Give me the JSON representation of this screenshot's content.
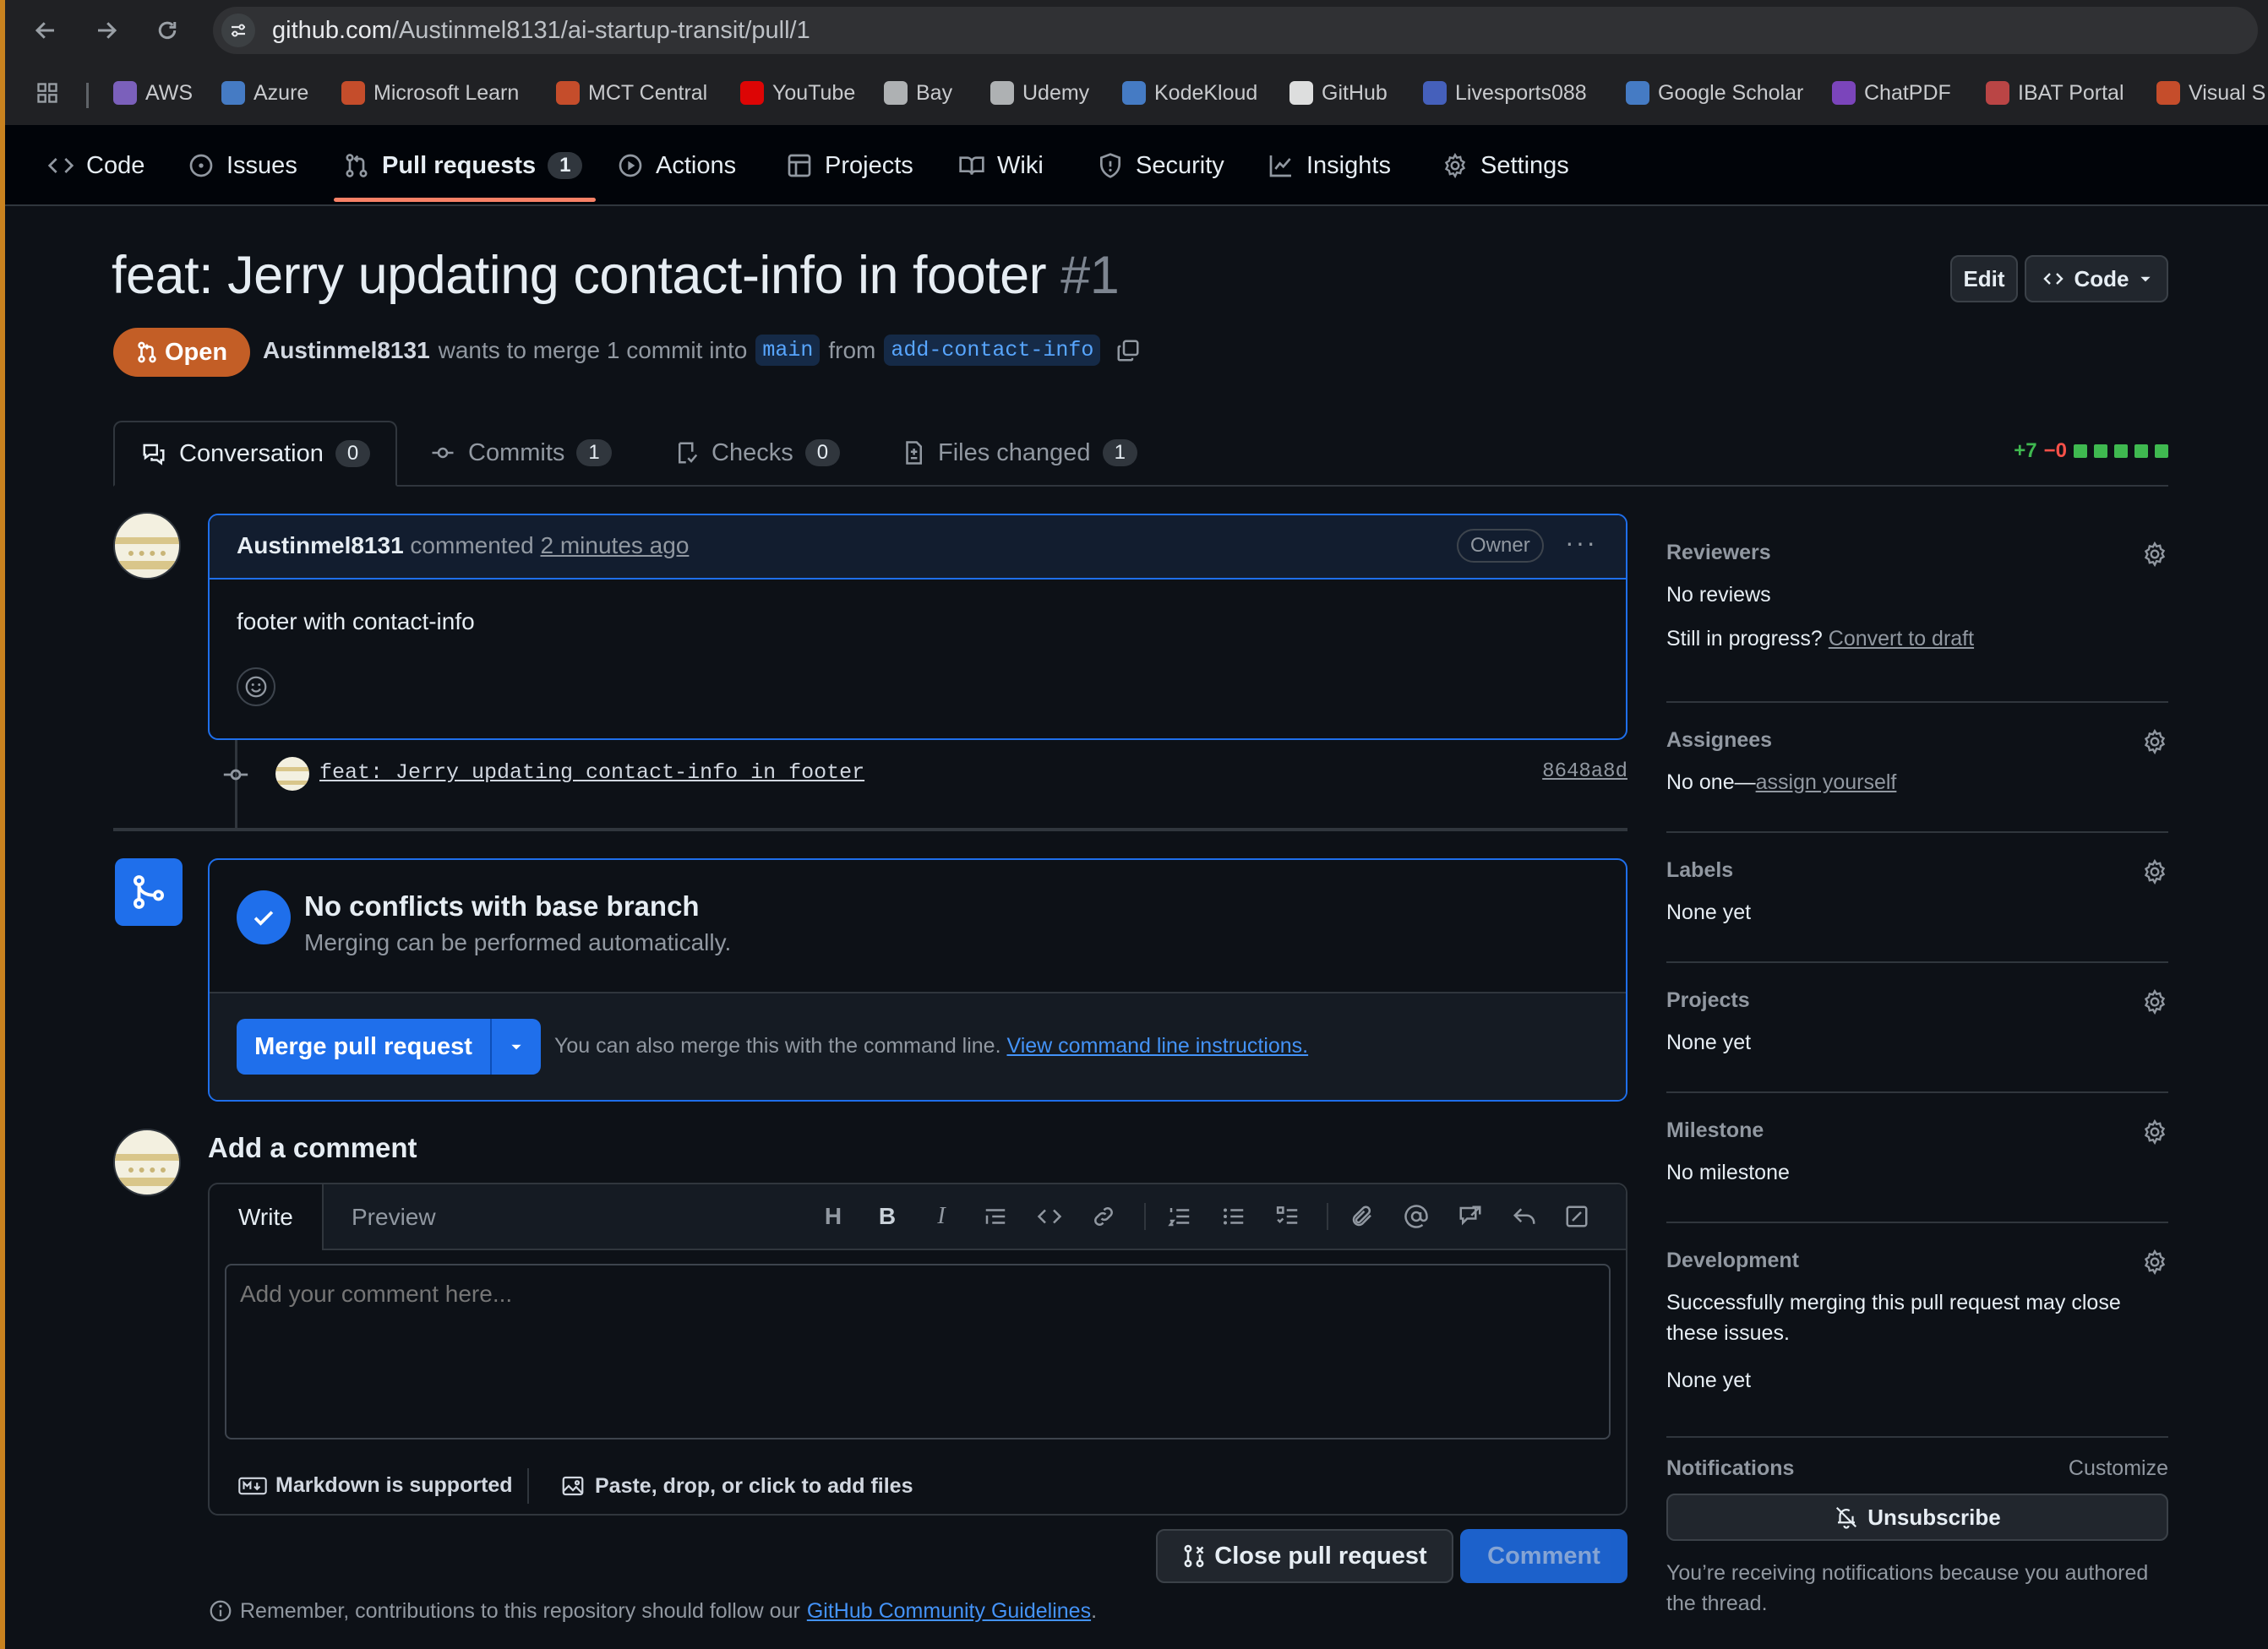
{
  "browser": {
    "url_host": "github.com",
    "url_path": "/Austinmel8131/ai-startup-transit/pull/1",
    "bookmarks": [
      {
        "label": "AWS",
        "color": "#8c6bd6"
      },
      {
        "label": "Azure",
        "color": "#4c8be0"
      },
      {
        "label": "Microsoft Learn",
        "color": "#e3552d"
      },
      {
        "label": "MCT Central",
        "color": "#e3552d"
      },
      {
        "label": "YouTube",
        "color": "#ff0000"
      },
      {
        "label": "Bay",
        "color": "#c8cacd"
      },
      {
        "label": "Udemy",
        "color": "#c8cacd"
      },
      {
        "label": "KodeKloud",
        "color": "#4c8be0"
      },
      {
        "label": "GitHub",
        "color": "#ffffff"
      },
      {
        "label": "Livesports088",
        "color": "#4c6bd6"
      },
      {
        "label": "Google Scholar",
        "color": "#4c8be0"
      },
      {
        "label": "ChatPDF",
        "color": "#8c4bd6"
      },
      {
        "label": "IBAT Portal",
        "color": "#d64b4b"
      },
      {
        "label": "Visual S",
        "color": "#e3552d"
      }
    ]
  },
  "repo_nav": {
    "tabs": [
      {
        "label": "Code",
        "icon": "code-icon"
      },
      {
        "label": "Issues",
        "icon": "issue-icon"
      },
      {
        "label": "Pull requests",
        "icon": "pull-request-icon",
        "count": "1",
        "active": true
      },
      {
        "label": "Actions",
        "icon": "play-icon"
      },
      {
        "label": "Projects",
        "icon": "table-icon"
      },
      {
        "label": "Wiki",
        "icon": "book-icon"
      },
      {
        "label": "Security",
        "icon": "shield-icon"
      },
      {
        "label": "Insights",
        "icon": "graph-icon"
      },
      {
        "label": "Settings",
        "icon": "gear-icon"
      }
    ]
  },
  "pr": {
    "title": "feat: Jerry updating contact-info in footer",
    "number": "#1",
    "edit_label": "Edit",
    "code_label": "Code",
    "state": "Open",
    "author": "Austinmel8131",
    "merge_text": "wants to merge 1 commit into",
    "base_branch": "main",
    "from_text": "from",
    "head_branch": "add-contact-info",
    "tabs": [
      {
        "label": "Conversation",
        "count": "0"
      },
      {
        "label": "Commits",
        "count": "1"
      },
      {
        "label": "Checks",
        "count": "0"
      },
      {
        "label": "Files changed",
        "count": "1"
      }
    ],
    "additions": "+7",
    "deletions": "−0"
  },
  "comment": {
    "author": "Austinmel8131",
    "action": "commented",
    "time": "2 minutes ago",
    "role": "Owner",
    "body": "footer with contact-info"
  },
  "commit": {
    "message": "feat: Jerry updating contact-info in footer",
    "sha": "8648a8d"
  },
  "merge": {
    "title": "No conflicts with base branch",
    "subtitle": "Merging can be performed automatically.",
    "button": "Merge pull request",
    "hint": "You can also merge this with the command line.",
    "hint_link": "View command line instructions."
  },
  "new_comment": {
    "heading": "Add a comment",
    "tab_write": "Write",
    "tab_preview": "Preview",
    "placeholder": "Add your comment here...",
    "markdown_note": "Markdown is supported",
    "attach_note": "Paste, drop, or click to add files",
    "close_button": "Close pull request",
    "comment_button": "Comment",
    "remember_text": "Remember, contributions to this repository should follow our",
    "remember_link": "GitHub Community Guidelines",
    "remember_end": "."
  },
  "sidebar": {
    "reviewers": {
      "heading": "Reviewers",
      "value": "No reviews",
      "draft_q": "Still in progress?",
      "draft_link": "Convert to draft"
    },
    "assignees": {
      "heading": "Assignees",
      "value": "No one—",
      "link": "assign yourself"
    },
    "labels": {
      "heading": "Labels",
      "value": "None yet"
    },
    "projects": {
      "heading": "Projects",
      "value": "None yet"
    },
    "milestone": {
      "heading": "Milestone",
      "value": "No milestone"
    },
    "development": {
      "heading": "Development",
      "line1": "Successfully merging this pull request may close",
      "line2": "these issues.",
      "value": "None yet"
    },
    "notifications": {
      "heading": "Notifications",
      "customize": "Customize",
      "button": "Unsubscribe",
      "line1": "You’re receiving notifications because you authored",
      "line2": "the thread."
    }
  },
  "colors": {
    "accent": "#1f6feb",
    "open_badge": "#c35e26",
    "link": "#4493f8"
  }
}
